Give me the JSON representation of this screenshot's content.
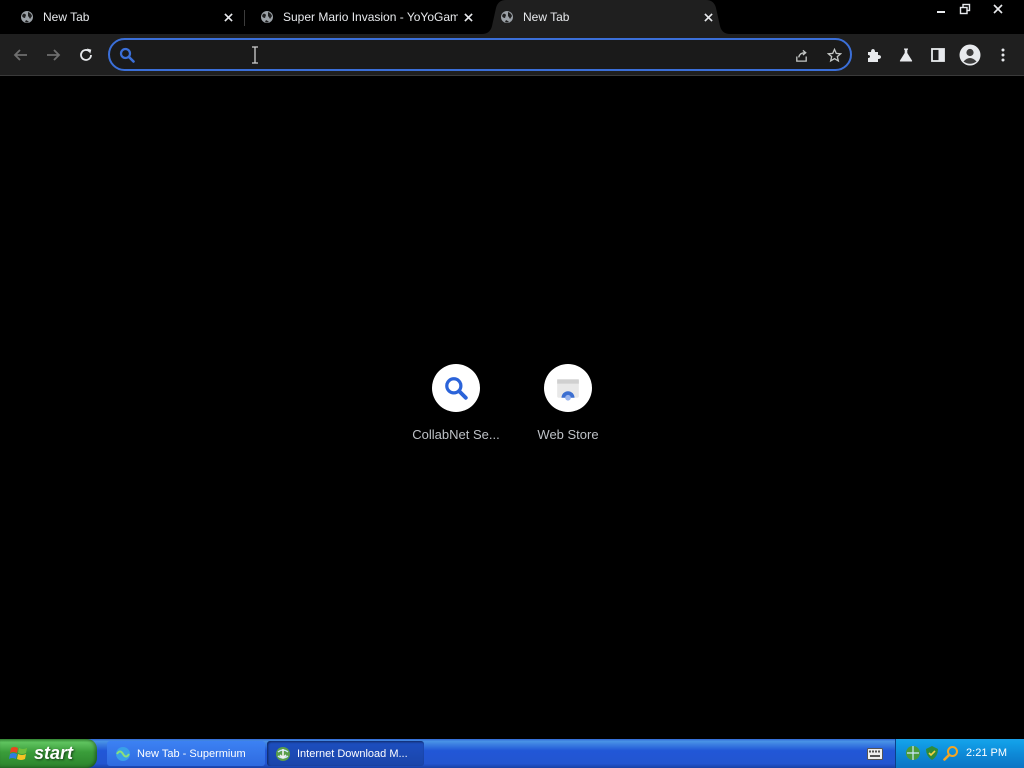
{
  "tabs": [
    {
      "title": "New Tab",
      "active": false
    },
    {
      "title": "Super Mario Invasion - YoYoGames",
      "active": false
    },
    {
      "title": "New Tab",
      "active": true
    }
  ],
  "omnibox": {
    "value": "",
    "placeholder": ""
  },
  "shortcuts": [
    {
      "label": "CollabNet Se...",
      "icon": "search-icon"
    },
    {
      "label": "Web Store",
      "icon": "web-store-icon"
    }
  ],
  "taskbar": {
    "start_label": "start",
    "tasks": [
      {
        "label": "New Tab - Supermium",
        "icon": "supermium-icon"
      },
      {
        "label": "Internet Download M...",
        "icon": "idm-icon"
      }
    ],
    "clock": "2:21 PM"
  },
  "colors": {
    "accent": "#3b6fd8",
    "toolbar_bg": "#1f1f1f",
    "ntp_bg": "#000000",
    "taskbar_blue": "#2355d0",
    "start_green": "#3a9d3a"
  }
}
